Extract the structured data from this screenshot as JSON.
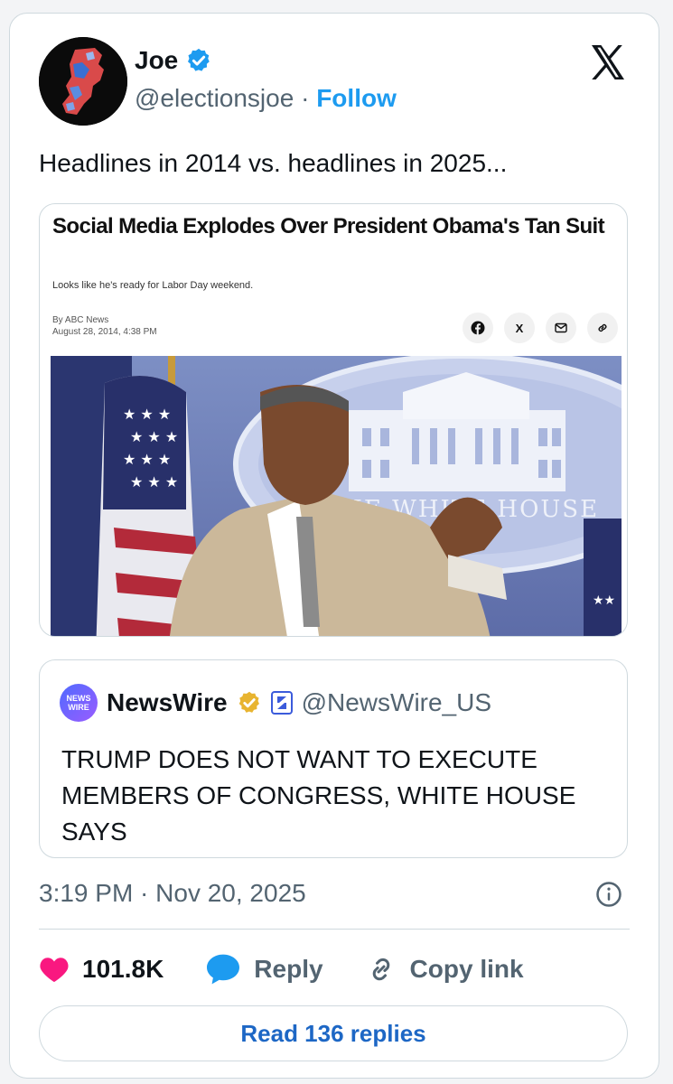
{
  "author": {
    "name": "Joe",
    "handle": "@electionsjoe",
    "separator": "·",
    "follow_label": "Follow"
  },
  "tweet": {
    "text": "Headlines in 2014 vs. headlines in 2025...",
    "timestamp": "3:19 PM · Nov 20, 2025"
  },
  "article": {
    "headline": "Social Media Explodes Over President Obama's Tan Suit",
    "subhead": "Looks like he's ready for Labor Day weekend.",
    "byline": "By ABC News",
    "date": "August 28, 2014, 4:38 PM",
    "share_icons": [
      "facebook-icon",
      "x-icon",
      "mail-icon",
      "link-icon"
    ],
    "share_x_label": "X",
    "podium_text": "THE WHITE HOUSE"
  },
  "quoted_tweet": {
    "logo_text": "NEWS WIRE",
    "name": "NewsWire",
    "handle": "@NewsWire_US",
    "text": "TRUMP DOES NOT WANT TO EXECUTE MEMBERS OF CONGRESS, WHITE HOUSE SAYS"
  },
  "actions": {
    "likes": "101.8K",
    "reply_label": "Reply",
    "copy_label": "Copy link"
  },
  "read_replies_label": "Read 136 replies",
  "colors": {
    "accent": "#1d9bf0",
    "heart": "#f91880",
    "reply_bubble": "#1d9bf0",
    "muted": "#536471"
  }
}
